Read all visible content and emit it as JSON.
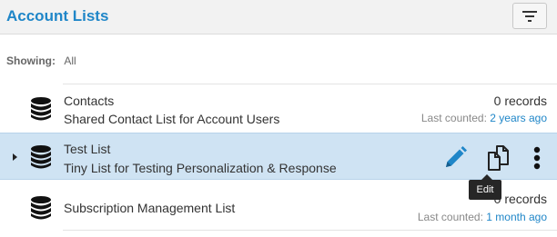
{
  "header": {
    "title": "Account Lists",
    "filter_icon": "filter-lines-icon"
  },
  "filter": {
    "label": "Showing:",
    "value": "All"
  },
  "lists": [
    {
      "name": "Contacts",
      "description": "Shared Contact List for Account Users",
      "records": "0 records",
      "last_counted_label": "Last counted:",
      "last_counted_value": "2 years ago",
      "selected": false
    },
    {
      "name": "Test List",
      "description": "Tiny List for Testing Personalization & Response",
      "selected": true
    },
    {
      "name": "Subscription Management List",
      "description": "",
      "records": "0 records",
      "last_counted_label": "Last counted:",
      "last_counted_value": "1 month ago",
      "selected": false
    }
  ],
  "row_actions": {
    "edit_icon": "pencil-icon",
    "copy_icon": "copy-icon",
    "more_icon": "more-vertical-icon"
  },
  "tooltip": {
    "text": "Edit"
  },
  "colors": {
    "accent": "#1f86c8",
    "selected_row": "#cfe3f3",
    "header_bg": "#f2f2f2"
  }
}
